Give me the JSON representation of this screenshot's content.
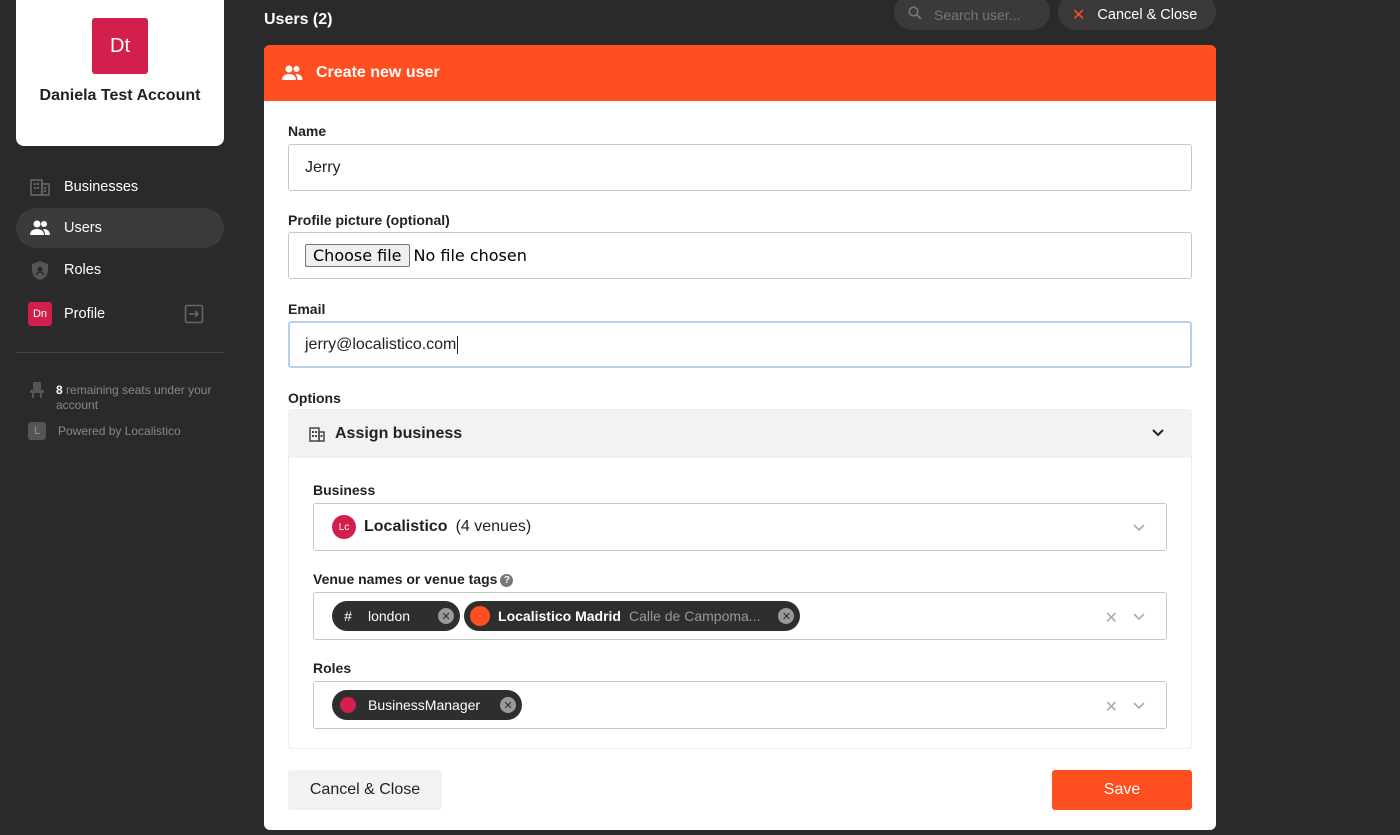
{
  "account": {
    "initials": "Dt",
    "name": "Daniela Test Account"
  },
  "sidebar": {
    "items": [
      {
        "label": "Businesses",
        "icon": "building-icon"
      },
      {
        "label": "Users",
        "icon": "users-icon"
      },
      {
        "label": "Roles",
        "icon": "shield-icon"
      },
      {
        "label": "Profile",
        "icon": "profile-avatar",
        "initials": "Dn"
      }
    ],
    "seats_count": "8",
    "seats_text": "remaining seats under your account",
    "powered_logo": "L",
    "powered_by": "Powered by Localistico"
  },
  "header": {
    "title": "Users (2)",
    "search_placeholder": "Search user...",
    "cancel_label": "Cancel & Close"
  },
  "form": {
    "title": "Create new user",
    "name_label": "Name",
    "name_value": "Jerry",
    "picture_label": "Profile picture (optional)",
    "file_button": "Choose file",
    "file_status": "No file chosen",
    "email_label": "Email",
    "email_value": "jerry@localistico.com",
    "options_label": "Options",
    "assign_business": {
      "title": "Assign business",
      "business_label": "Business",
      "business_initials": "Lc",
      "business_name": "Localistico",
      "business_count": "(4 venues)",
      "venues_label": "Venue names or venue tags",
      "venue_chips": [
        {
          "icon": "hash-icon",
          "label": "london",
          "sub": ""
        },
        {
          "icon": "venue-avatar",
          "label": "Localistico Madrid",
          "sub": "Calle de Campoma..."
        }
      ],
      "roles_label": "Roles",
      "role_chips": [
        {
          "label": "BusinessManager"
        }
      ]
    },
    "cancel_label": "Cancel & Close",
    "save_label": "Save"
  },
  "colors": {
    "accent": "#ff4e1f",
    "brand_avatar": "#d21f4b",
    "background": "#2a2a2a"
  }
}
